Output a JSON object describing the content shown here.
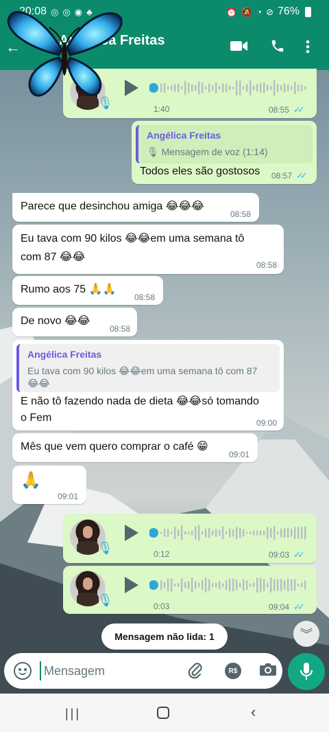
{
  "status_bar": {
    "time": "20:08",
    "battery": "76%",
    "left_icons": [
      "whatsapp-icon",
      "whatsapp-icon",
      "chrome-icon",
      "notification-icon"
    ],
    "right_icons": [
      "alarm-icon",
      "mute-icon",
      "wifi-icon",
      "do-not-disturb-icon",
      "battery-icon"
    ]
  },
  "header": {
    "contact_name": "Angélica Freitas",
    "accent": "#0c8a6c",
    "icons": [
      "back-arrow-icon",
      "video-call-icon",
      "phone-icon",
      "more-options-icon"
    ]
  },
  "messages": [
    {
      "kind": "voice",
      "direction": "out",
      "duration": "1:40",
      "time": "08:55",
      "read": true
    },
    {
      "kind": "text",
      "direction": "out",
      "quote_name": "Angélica Freitas",
      "quote_text": "🎙 Mensagem de voz (1:14)",
      "text": "Todos eles são gostosos",
      "time": "08:57",
      "read": true
    },
    {
      "kind": "text",
      "direction": "in",
      "text": "Parece que desinchou amiga 😂😂😂",
      "time": "08:58"
    },
    {
      "kind": "text",
      "direction": "in",
      "text_line1": "Eu tava com 90 kilos 😂😂em uma semana tô",
      "text_line2": "com 87 😂😂",
      "time": "08:58"
    },
    {
      "kind": "text",
      "direction": "in",
      "text": "Rumo aos 75 🙏🙏",
      "time": "08:58"
    },
    {
      "kind": "text",
      "direction": "in",
      "text": "De novo 😂😂",
      "time": "08:58"
    },
    {
      "kind": "text",
      "direction": "in",
      "quote_name": "Angélica Freitas",
      "quote_text_line1": "Eu tava com 90 kilos 😂😂em uma semana tô com 87",
      "quote_text_line2": "😂😂",
      "text_line1": "E não tô fazendo nada de dieta 😂😂só tomando",
      "text_line2": "o Fem",
      "time": "09:00"
    },
    {
      "kind": "text",
      "direction": "in",
      "text": "Mês que vem quero comprar o café 😁",
      "time": "09:01"
    },
    {
      "kind": "text",
      "direction": "in",
      "text": "🙏",
      "time": "09:01"
    },
    {
      "kind": "voice",
      "direction": "out",
      "duration": "0:12",
      "time": "09:03",
      "read": true
    },
    {
      "kind": "voice",
      "direction": "out",
      "duration": "0:03",
      "time": "09:04",
      "read": true
    }
  ],
  "unread_chip": "Mensagem não lida: 1",
  "composer": {
    "placeholder": "Mensagem",
    "pay_label": "R$"
  },
  "read_ticks": "✓✓",
  "colors": {
    "outgoing": "#dcf8c6",
    "incoming": "#ffffff",
    "ticks": "#34b7f1"
  }
}
